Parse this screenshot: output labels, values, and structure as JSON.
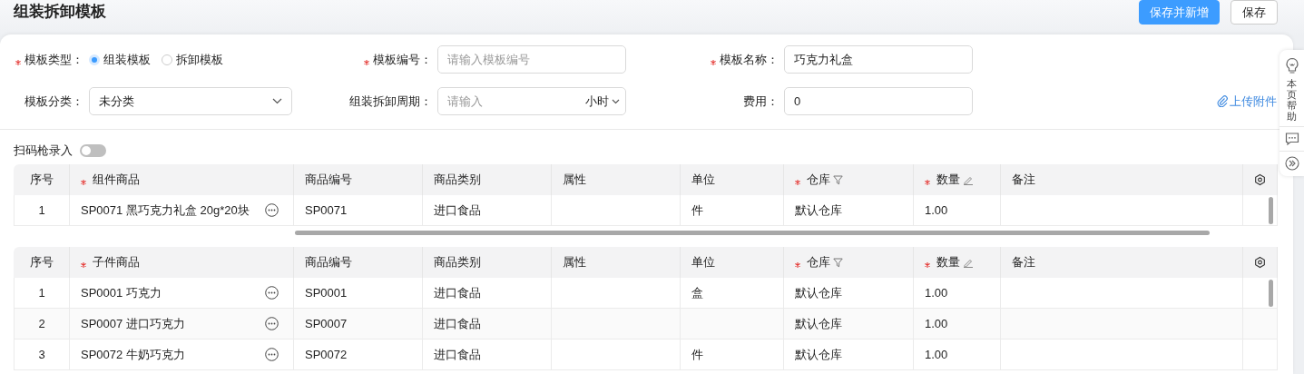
{
  "page_title": "组装拆卸模板",
  "actions": [
    {
      "label": "保存并新增",
      "kind": "primary"
    },
    {
      "label": "保存",
      "kind": "default"
    }
  ],
  "form": {
    "fields": [
      {
        "label": "模板类型：",
        "kind": "radio",
        "required": true,
        "options": [
          {
            "label": "组装模板",
            "selected": true
          },
          {
            "label": "拆卸模板",
            "selected": false
          }
        ]
      },
      {
        "label": "模板编号：",
        "kind": "input",
        "required": true,
        "placeholder": "请输入模板编号"
      },
      {
        "label": "模板名称：",
        "kind": "input",
        "required": true,
        "value": "巧克力礼盒"
      },
      {
        "label": "模板分类：",
        "kind": "select",
        "required": false,
        "value": "未分类"
      },
      {
        "label": "组装拆卸周期：",
        "kind": "input_unit",
        "required": false,
        "placeholder": "请输入",
        "unit": "小时"
      },
      {
        "label": "费用：",
        "kind": "input",
        "required": false,
        "value": "0"
      }
    ],
    "upload_link": "上传附件"
  },
  "scan_toggle": {
    "label": "扫码枪录入",
    "on": false
  },
  "help_panel": {
    "help_label": "本页帮助"
  },
  "tables": [
    {
      "columns": [
        {
          "label": "序号",
          "required": false
        },
        {
          "label": "组件商品",
          "required": true
        },
        {
          "label": "商品编号",
          "required": false
        },
        {
          "label": "商品类别",
          "required": false
        },
        {
          "label": "属性",
          "required": false
        },
        {
          "label": "单位",
          "required": false
        },
        {
          "label": "仓库",
          "required": true,
          "filterable": true
        },
        {
          "label": "数量",
          "required": true,
          "editable": true
        },
        {
          "label": "备注",
          "required": false
        }
      ],
      "rows": [
        {
          "index": "1",
          "product": "SP0071 黑巧克力礼盒 20g*20块",
          "code": "SP0071",
          "category": "进口食品",
          "unit": "件",
          "warehouse": "默认仓库",
          "quantity": "1.00"
        }
      ]
    },
    {
      "columns": [
        {
          "label": "序号",
          "required": false
        },
        {
          "label": "子件商品",
          "required": true
        },
        {
          "label": "商品编号",
          "required": false
        },
        {
          "label": "商品类别",
          "required": false
        },
        {
          "label": "属性",
          "required": false
        },
        {
          "label": "单位",
          "required": false
        },
        {
          "label": "仓库",
          "required": true,
          "filterable": true
        },
        {
          "label": "数量",
          "required": true,
          "editable": true
        },
        {
          "label": "备注",
          "required": false
        }
      ],
      "rows": [
        {
          "index": "1",
          "product": "SP0001 巧克力",
          "code": "SP0001",
          "category": "进口食品",
          "unit": "盒",
          "warehouse": "默认仓库",
          "quantity": "1.00"
        },
        {
          "index": "2",
          "product": "SP0007 进口巧克力",
          "code": "SP0007",
          "category": "进口食品",
          "warehouse": "默认仓库",
          "quantity": "1.00"
        },
        {
          "index": "3",
          "product": "SP0072 牛奶巧克力",
          "code": "SP0072",
          "category": "进口食品",
          "unit": "件",
          "warehouse": "默认仓库",
          "quantity": "1.00"
        }
      ]
    }
  ]
}
